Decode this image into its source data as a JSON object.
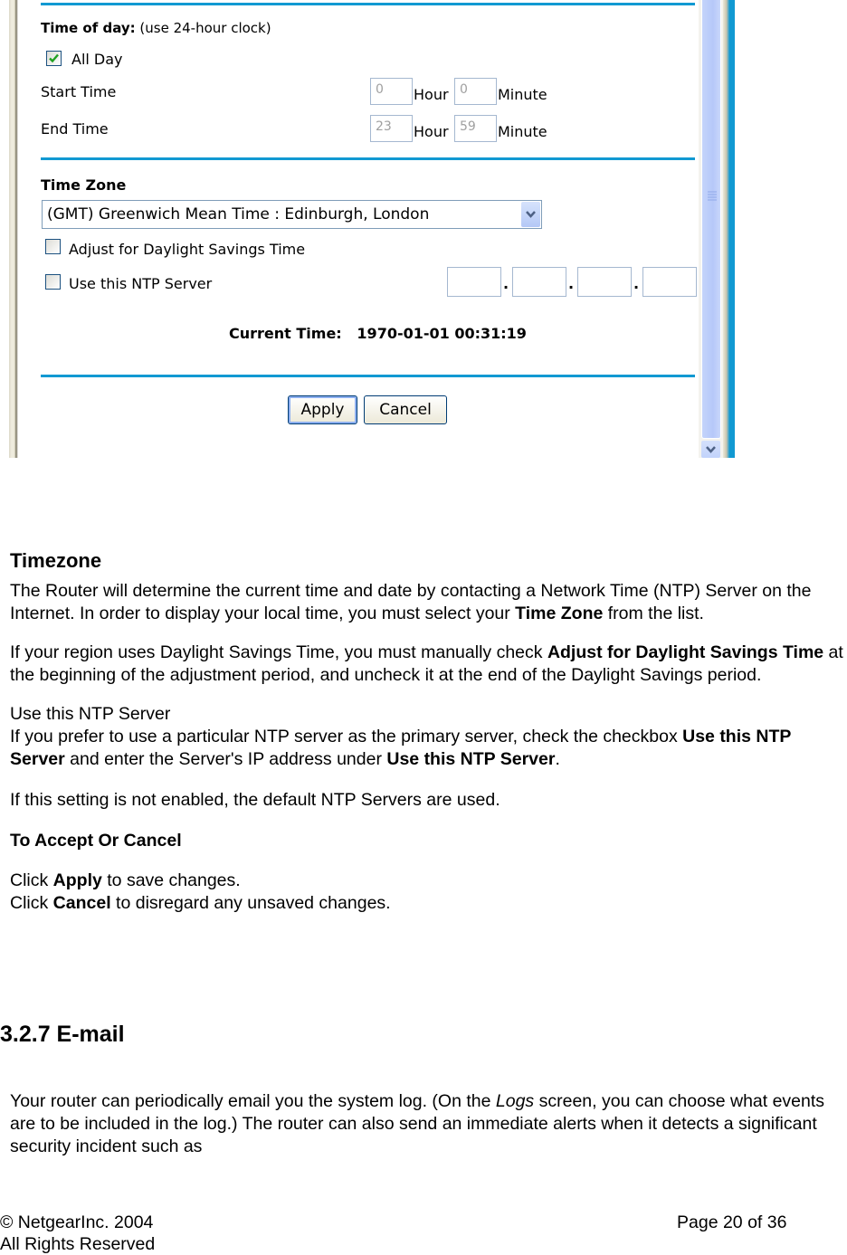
{
  "screenshot": {
    "time_of_day": {
      "label_bold": "Time of day:",
      "label_note": "(use 24-hour clock)",
      "all_day": {
        "label": "All Day",
        "checked": true
      },
      "start_time": {
        "label": "Start Time",
        "hour": "0",
        "minute": "0"
      },
      "end_time": {
        "label": "End Time",
        "hour": "23",
        "minute": "59"
      },
      "hour_label": "Hour",
      "minute_label": "Minute"
    },
    "time_zone": {
      "label": "Time Zone",
      "selected": "(GMT) Greenwich Mean Time : Edinburgh, London",
      "adjust_dst": {
        "label": "Adjust for Daylight Savings Time",
        "checked": false
      },
      "use_ntp": {
        "label": "Use this NTP Server",
        "checked": false
      },
      "ntp_ip": [
        "",
        "",
        "",
        ""
      ],
      "ip_separator": "."
    },
    "current_time": {
      "label": "Current Time:",
      "value": "1970-01-01 00:31:19"
    },
    "buttons": {
      "apply": "Apply",
      "cancel": "Cancel"
    },
    "colors": {
      "rule": "#1199d2",
      "checkmark": "#21a121",
      "scrollbar": "#b6c8f9"
    }
  },
  "document": {
    "timezone_heading": "Timezone",
    "p1_a": "The Router will determine the current time and date by contacting a Network Time (NTP) Server on the Internet. In order to display your local time, you must select your ",
    "p1_b": "Time Zone",
    "p1_c": " from the list.",
    "p2_a": "If your region uses Daylight Savings Time, you must manually check ",
    "p2_b": "Adjust for Daylight Savings Time",
    "p2_c": " at the beginning of the adjustment period, and uncheck it at the end of the Daylight Savings period.",
    "ntp_title": "Use this NTP Server",
    "p3_a": "If you prefer to use a particular NTP server as the primary server, check the checkbox ",
    "p3_b": "Use this NTP Server",
    "p3_c": " and enter the Server's IP address under ",
    "p3_d": "Use this NTP Server",
    "p3_e": ".",
    "p4": "If this setting is not enabled, the default NTP Servers are used.",
    "accept_heading": "To Accept Or Cancel",
    "click": "Click ",
    "apply_bold": "Apply",
    "apply_rest": " to save changes.",
    "cancel_bold": "Cancel",
    "cancel_rest": " to disregard any unsaved changes.",
    "section_heading": "3.2.7  E-mail",
    "p5_a": "Your router can periodically email you the system log. (On the ",
    "p5_b": "Logs",
    "p5_c": " screen, you can choose what events are to be included in the log.) The router can also send an immediate alerts when it detects a significant security incident such as"
  },
  "footer": {
    "copyright": "© NetgearInc. 2004",
    "rights": "All Rights Reserved",
    "page": "Page 20 of 36"
  }
}
